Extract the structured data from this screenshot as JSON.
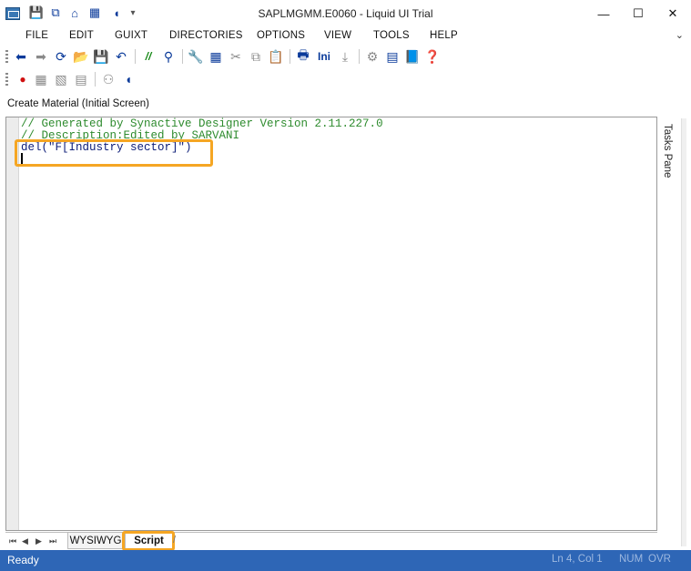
{
  "window": {
    "title": "SAPLMGMM.E0060 - Liquid UI Trial",
    "minimize_glyph": "—",
    "maximize_glyph": "☐",
    "close_glyph": "✕"
  },
  "quick_access": {
    "icons": [
      "save-icon",
      "copy-icon",
      "home-icon",
      "screen-icon",
      "video-icon",
      "dropdown-arrow-icon"
    ],
    "dropdown_glyph": "▾"
  },
  "menu": {
    "items": [
      "FILE",
      "EDIT",
      "GUIXT",
      "DIRECTORIES",
      "OPTIONS",
      "VIEW",
      "TOOLS",
      "HELP"
    ],
    "overflow_glyph": "⌄"
  },
  "toolbar1": {
    "ini_label": "Ini",
    "comment_label": "//"
  },
  "screen": {
    "label": "Create Material (Initial Screen)"
  },
  "editor": {
    "lines": [
      "// Generated by Synactive Designer Version 2.11.227.0",
      "// Description:Edited by SARVANI",
      "del(\"F[Industry sector]\")"
    ]
  },
  "tasks_pane": {
    "label": "Tasks Pane"
  },
  "tabs": {
    "wysiwyg": "WYSIWYG",
    "script": "Script"
  },
  "status": {
    "ready": "Ready",
    "position": "Ln 4, Col 1",
    "num": "NUM",
    "ovr": "OVR"
  },
  "colors": {
    "status_bar": "#2e66b6",
    "highlight": "#f5a623",
    "comment": "#2e8b2e",
    "code": "#10207a"
  }
}
